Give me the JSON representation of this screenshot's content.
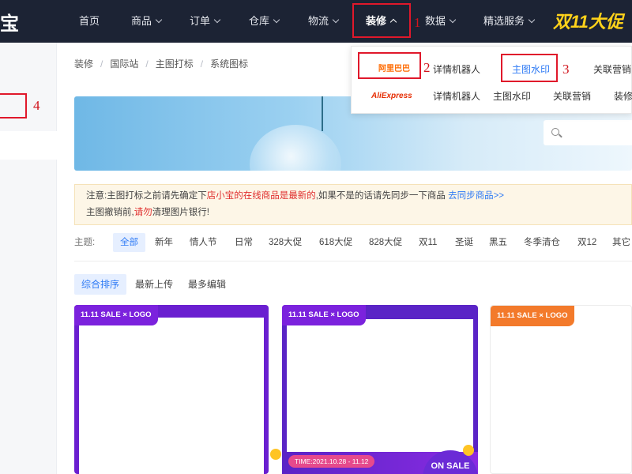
{
  "brand": "宝",
  "nav": {
    "items": [
      "首页",
      "商品",
      "订单",
      "仓库",
      "物流",
      "装修",
      "数据",
      "精选服务"
    ],
    "promo": "双11大促"
  },
  "markers": [
    "1",
    "2",
    "3",
    "4"
  ],
  "breadcrumb": [
    "装修",
    "国际站",
    "主图打标",
    "系统图标"
  ],
  "dropdown": {
    "row1": {
      "logo": "阿里巴巴",
      "items": [
        "详情机器人",
        "主图水印",
        "关联营销"
      ]
    },
    "row2": {
      "logo": "AliExpress",
      "items": [
        "详情机器人",
        "主图水印",
        "关联营销",
        "装修"
      ]
    }
  },
  "notice": {
    "line1_a": "注意:主图打标之前请先确定下",
    "line1_red": "店小宝的在线商品是最新的",
    "line1_b": ",如果不是的话请先同步一下商品 ",
    "line1_link": "去同步商品>>",
    "line2_a": "主图撤销前,",
    "line2_red": "请勿",
    "line2_b": "清理图片银行!"
  },
  "theme": {
    "label": "主题:",
    "tags": [
      "全部",
      "新年",
      "情人节",
      "日常",
      "328大促",
      "618大促",
      "828大促",
      "双11",
      "圣诞",
      "黑五",
      "冬季清仓",
      "双12",
      "其它"
    ]
  },
  "sort": {
    "tabs": [
      "综合排序",
      "最新上传",
      "最多编辑"
    ]
  },
  "cards": {
    "tag": "11.11 SALE × LOGO",
    "time": "TIME:2021.10.28 - 11.12",
    "on_sale": "ON SALE"
  },
  "colors": {
    "nav_bg": "#1c2334",
    "promo": "#ffd21a",
    "highlight": "#e0182b",
    "link": "#2f7bf5",
    "card_purple": "#6a1fd0",
    "card_orange": "#f37a2b"
  }
}
